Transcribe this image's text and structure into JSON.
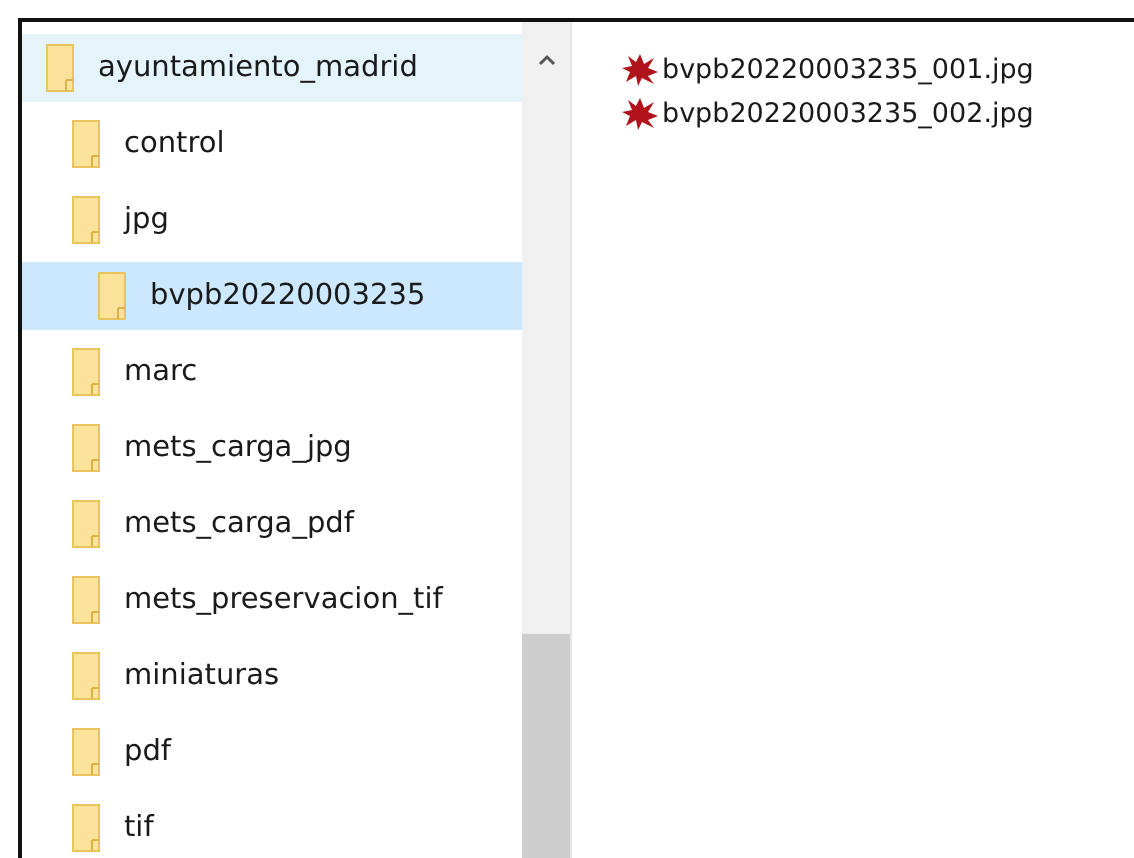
{
  "navigation_tree": [
    {
      "label": "ayuntamiento_madrid",
      "selected": false,
      "hovered": true,
      "children": [
        {
          "label": "control",
          "selected": false,
          "hovered": false
        },
        {
          "label": "jpg",
          "selected": false,
          "hovered": false,
          "children": [
            {
              "label": "bvpb20220003235",
              "selected": true,
              "hovered": false
            }
          ]
        },
        {
          "label": "marc",
          "selected": false,
          "hovered": false
        },
        {
          "label": "mets_carga_jpg",
          "selected": false,
          "hovered": false
        },
        {
          "label": "mets_carga_pdf",
          "selected": false,
          "hovered": false
        },
        {
          "label": "mets_preservacion_tif",
          "selected": false,
          "hovered": false
        },
        {
          "label": "miniaturas",
          "selected": false,
          "hovered": false
        },
        {
          "label": "pdf",
          "selected": false,
          "hovered": false
        },
        {
          "label": "tif",
          "selected": false,
          "hovered": false
        }
      ]
    }
  ],
  "files": [
    {
      "name": "bvpb20220003235_001.jpg"
    },
    {
      "name": "bvpb20220003235_002.jpg"
    }
  ]
}
